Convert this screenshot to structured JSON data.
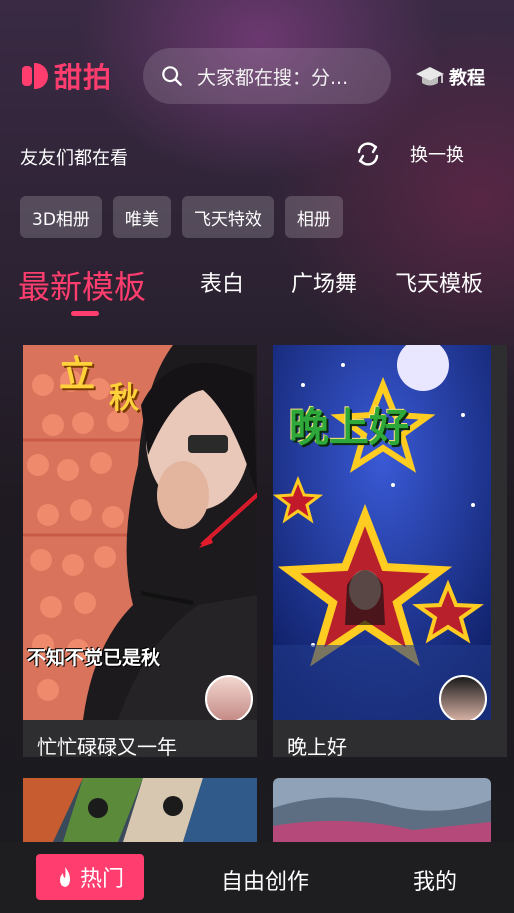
{
  "header": {
    "logo_text": "甜拍",
    "search_placeholder": "大家都在搜：分...",
    "tutorial_label": "教程"
  },
  "friends": {
    "title": "友友们都在看",
    "swap_label": "换一换"
  },
  "chips": [
    "3D相册",
    "唯美",
    "飞天特效",
    "相册"
  ],
  "tabs": {
    "active": "最新模板",
    "items": [
      "表白",
      "广场舞",
      "飞天模板"
    ]
  },
  "cards": [
    {
      "title": "忙忙碌碌又一年",
      "overlay_top": "立",
      "overlay_top2": "秋",
      "caption": "不知不觉已是秋"
    },
    {
      "title": "晚上好",
      "overlay_top": "晚上好"
    }
  ],
  "bottom_nav": {
    "hot": "热门",
    "create": "自由创作",
    "mine": "我的"
  },
  "colors": {
    "accent": "#ff3d6e",
    "background": "#1b1b1e"
  }
}
